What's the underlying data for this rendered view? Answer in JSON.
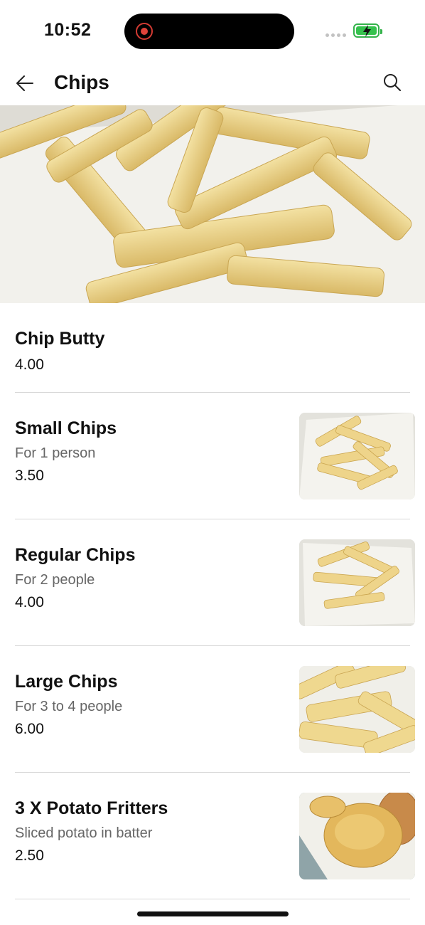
{
  "status": {
    "time": "10:52"
  },
  "header": {
    "title": "Chips"
  },
  "items": [
    {
      "name": "Chip Butty",
      "desc": "",
      "price": "4.00"
    },
    {
      "name": "Small Chips",
      "desc": "For 1 person",
      "price": "3.50"
    },
    {
      "name": "Regular Chips",
      "desc": "For 2 people",
      "price": "4.00"
    },
    {
      "name": "Large Chips",
      "desc": "For 3 to 4 people",
      "price": "6.00"
    },
    {
      "name": "3 X Potato Fritters",
      "desc": "Sliced potato in batter",
      "price": "2.50"
    }
  ],
  "icons": {
    "back": "arrow-left-icon",
    "search": "search-icon",
    "record": "screen-recording-icon",
    "battery": "battery-charging-icon"
  },
  "colors": {
    "battery": "#35c24d",
    "record": "#e0433a",
    "divider": "#d8d8d8"
  }
}
